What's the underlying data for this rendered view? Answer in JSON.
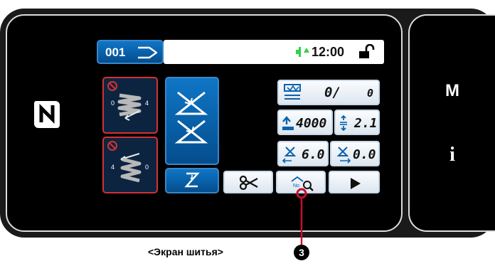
{
  "header": {
    "pattern_no": "001",
    "clock": "12:00"
  },
  "panel": {
    "counter_current": "0/",
    "counter_total": "0",
    "max_speed": "4000",
    "stitch_length": "2.1",
    "left_width": "6.0",
    "right_width": "0.0"
  },
  "side_buttons": {
    "mode_label": "M",
    "info_label": "i"
  },
  "caption": {
    "text": "<Экран шитья>",
    "callout_number": "3"
  },
  "colors": {
    "accent_blue": "#0a62ad",
    "prohibited_red": "#d23232",
    "status_green": "#2fd14a",
    "callout_red": "#c8102e"
  },
  "icons": [
    "nfc-icon",
    "pattern-arrow-icon",
    "connection-icon",
    "unlock-icon",
    "reverse-stitch-start-icon",
    "reverse-stitch-end-icon",
    "zigzag-pattern-icon",
    "zigzag-small-icon",
    "counter-icon",
    "speed-icon",
    "stitch-length-icon",
    "left-width-icon",
    "right-width-icon",
    "thread-trim-icon",
    "search-icon",
    "play-icon"
  ]
}
